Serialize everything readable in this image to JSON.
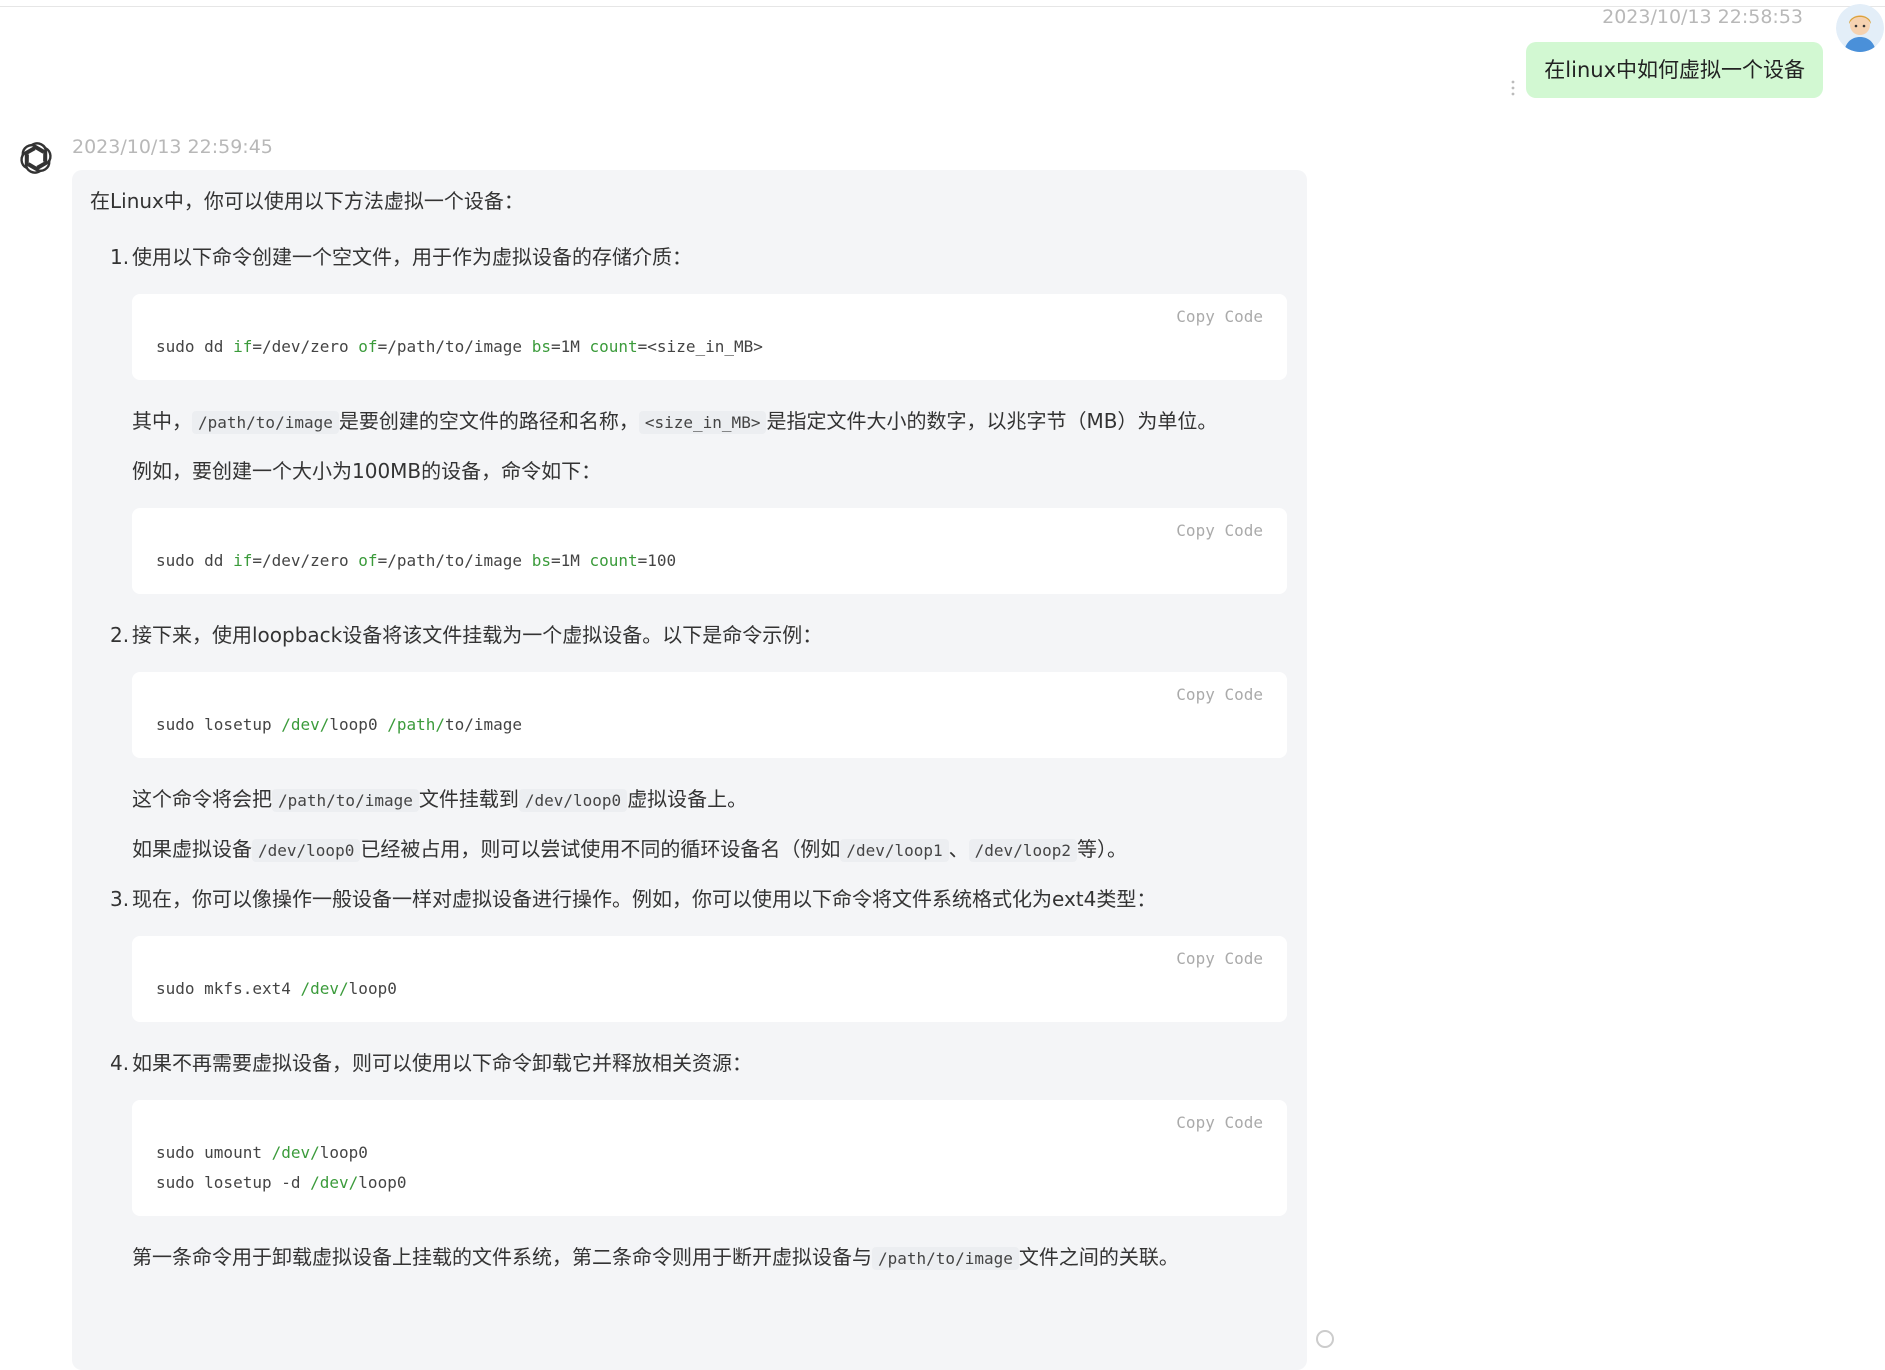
{
  "user": {
    "timestamp": "2023/10/13 22:58:53",
    "message": "在linux中如何虚拟一个设备"
  },
  "assistant": {
    "timestamp": "2023/10/13 22:59:45",
    "intro": "在Linux中，你可以使用以下方法虚拟一个设备：",
    "copy_label": "Copy Code",
    "step1": {
      "num": "1.",
      "text": "使用以下命令创建一个空文件，用于作为虚拟设备的存储介质：",
      "code_a": {
        "c1": "sudo dd ",
        "k1": "if",
        "c2": "=/dev/zero ",
        "k2": "of",
        "c3": "=/path/to/image ",
        "k3": "bs",
        "c4": "=1M ",
        "k4": "count",
        "c5": "=<size_in_MB>"
      },
      "desc_pre": "其中，",
      "desc_code1": "/path/to/image",
      "desc_mid": "是要创建的空文件的路径和名称，",
      "desc_code2": "<size_in_MB>",
      "desc_post": "是指定文件大小的数字，以兆字节（MB）为单位。",
      "example": "例如，要创建一个大小为100MB的设备，命令如下：",
      "code_b": {
        "c1": "sudo dd ",
        "k1": "if",
        "c2": "=/dev/zero ",
        "k2": "of",
        "c3": "=/path/to/image ",
        "k3": "bs",
        "c4": "=1M ",
        "k4": "count",
        "c5": "=100"
      }
    },
    "step2": {
      "num": "2.",
      "text": "接下来，使用loopback设备将该文件挂载为一个虚拟设备。以下是命令示例：",
      "code": {
        "c1": "sudo losetup ",
        "g1": "/dev/",
        "c2": "loop0 ",
        "g2": "/path/",
        "c3": "to/image"
      },
      "d1_pre": "这个命令将会把",
      "d1_code1": "/path/to/image",
      "d1_mid": "文件挂载到",
      "d1_code2": "/dev/loop0",
      "d1_post": "虚拟设备上。",
      "d2_pre": "如果虚拟设备",
      "d2_code1": "/dev/loop0",
      "d2_mid": "已经被占用，则可以尝试使用不同的循环设备名（例如",
      "d2_code2": "/dev/loop1",
      "d2_sep": "、",
      "d2_code3": "/dev/loop2",
      "d2_post": "等）。"
    },
    "step3": {
      "num": "3.",
      "text": "现在，你可以像操作一般设备一样对虚拟设备进行操作。例如，你可以使用以下命令将文件系统格式化为ext4类型：",
      "code": {
        "c1": "sudo mkfs.ext4 ",
        "g1": "/dev/",
        "c2": "loop0"
      }
    },
    "step4": {
      "num": "4.",
      "text": "如果不再需要虚拟设备，则可以使用以下命令卸载它并释放相关资源：",
      "code_l1": {
        "c1": "sudo umount ",
        "g1": "/dev/",
        "c2": "loop0"
      },
      "code_l2": {
        "c1": "sudo losetup -d ",
        "g1": "/dev/",
        "c2": "loop0"
      },
      "d_pre": "第一条命令用于卸载虚拟设备上挂载的文件系统，第二条命令则用于断开虚拟设备与",
      "d_code": "/path/to/image",
      "d_post": "文件之间的关联。"
    }
  },
  "icons": {
    "bot": "openai-logo-icon",
    "user": "user-avatar-icon",
    "menu": "more-vertical-icon"
  }
}
